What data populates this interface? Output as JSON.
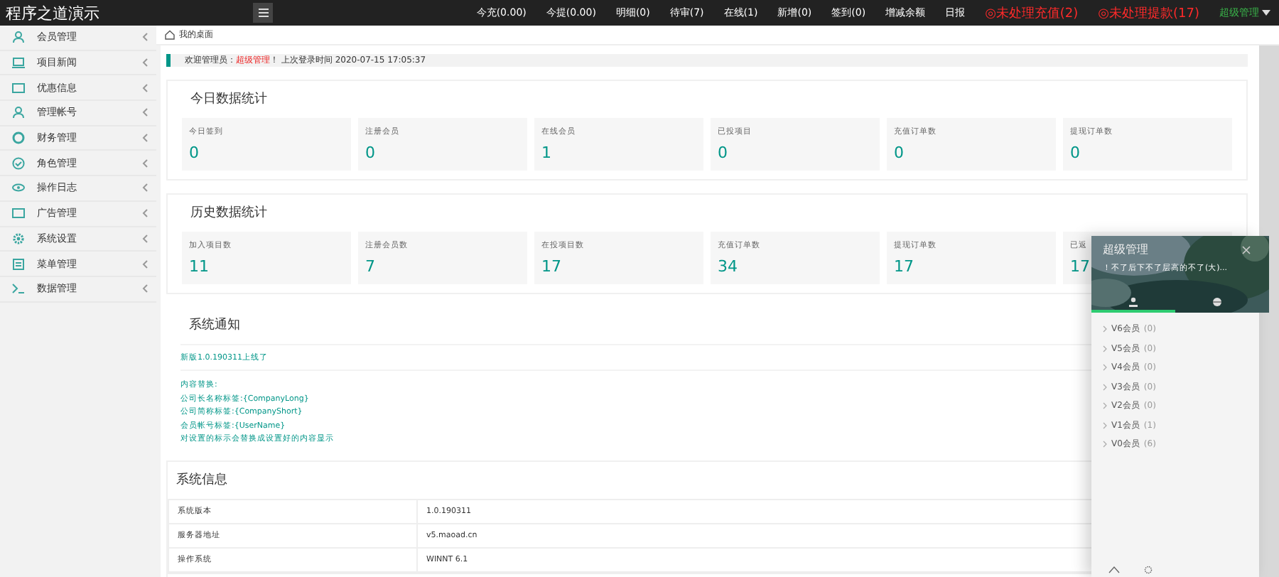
{
  "app": {
    "title": "程序之道演示"
  },
  "top_nav": [
    {
      "label": "今充(0.00)",
      "kind": "plain"
    },
    {
      "label": "今提(0.00)",
      "kind": "plain"
    },
    {
      "label": "明细(0)",
      "kind": "plain"
    },
    {
      "label": "待审(7)",
      "kind": "plain"
    },
    {
      "label": "在线(1)",
      "kind": "plain"
    },
    {
      "label": "新增(0)",
      "kind": "plain"
    },
    {
      "label": "签到(0)",
      "kind": "plain"
    },
    {
      "label": "增减余额",
      "kind": "plain"
    },
    {
      "label": "日报",
      "kind": "plain"
    },
    {
      "label": "◎未处理充值(2)",
      "kind": "alert"
    },
    {
      "label": "◎未处理提款(17)",
      "kind": "alert"
    },
    {
      "label": "超级管理",
      "kind": "user"
    }
  ],
  "sidebar": {
    "items": [
      {
        "label": "会员管理"
      },
      {
        "label": "项目新闻"
      },
      {
        "label": "优惠信息"
      },
      {
        "label": "管理帐号"
      },
      {
        "label": "财务管理"
      },
      {
        "label": "角色管理"
      },
      {
        "label": "操作日志"
      },
      {
        "label": "广告管理"
      },
      {
        "label": "系统设置"
      },
      {
        "label": "菜单管理"
      },
      {
        "label": "数据管理"
      }
    ]
  },
  "breadcrumb": "我的桌面",
  "welcome": {
    "prefix": "欢迎管理员：",
    "name": "超级管理",
    "suffix": "！ 上次登录时间 2020-07-15 17:05:37"
  },
  "today_stats": {
    "title": "今日数据统计",
    "cards": [
      {
        "label": "今日签到",
        "value": "0"
      },
      {
        "label": "注册会员",
        "value": "0"
      },
      {
        "label": "在线会员",
        "value": "1"
      },
      {
        "label": "已投项目",
        "value": "0"
      },
      {
        "label": "充值订单数",
        "value": "0"
      },
      {
        "label": "提现订单数",
        "value": "0"
      }
    ]
  },
  "history_stats": {
    "title": "历史数据统计",
    "cards": [
      {
        "label": "加入项目数",
        "value": "11"
      },
      {
        "label": "注册会员数",
        "value": "7"
      },
      {
        "label": "在投项目数",
        "value": "17"
      },
      {
        "label": "充值订单数",
        "value": "34"
      },
      {
        "label": "提现订单数",
        "value": "17"
      },
      {
        "label": "已返",
        "value": "17"
      }
    ]
  },
  "notice": {
    "title": "系统通知",
    "headline": "新版1.0.190311上线了",
    "lines": [
      "内容替换:",
      "公司长名称标签:{CompanyLong}",
      "公司简称标签:{CompanyShort}",
      "会员帐号标签:{UserName}",
      "对设置的标示会替换成设置好的内容显示"
    ]
  },
  "system_info": {
    "title": "系统信息",
    "rows": [
      {
        "name": "系统版本",
        "value": "1.0.190311"
      },
      {
        "name": "服务器地址",
        "value": "v5.maoad.cn"
      },
      {
        "name": "操作系统",
        "value": "WINNT 6.1"
      }
    ]
  },
  "popup": {
    "title": "超级管理",
    "subtitle": "！不了后下不了层高的不了(大)...",
    "tabs": [
      {
        "selected": true
      },
      {
        "selected": false
      }
    ],
    "groups": [
      {
        "name": "V6会员",
        "count": "(0)"
      },
      {
        "name": "V5会员",
        "count": "(0)"
      },
      {
        "name": "V4会员",
        "count": "(0)"
      },
      {
        "name": "V3会员",
        "count": "(0)"
      },
      {
        "name": "V2会员",
        "count": "(0)"
      },
      {
        "name": "V1会员",
        "count": "(1)"
      },
      {
        "name": "V0会员",
        "count": "(6)"
      }
    ]
  }
}
